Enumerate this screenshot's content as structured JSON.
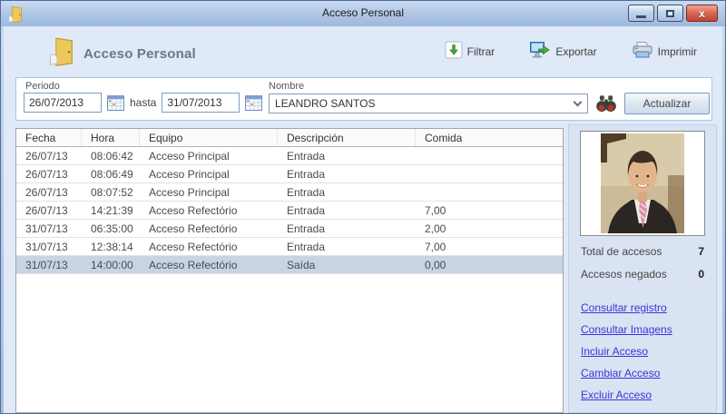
{
  "window": {
    "title": "Acceso Personal",
    "controls": {
      "minimize": "minimize",
      "maximize": "maximize",
      "close": "x"
    }
  },
  "header": {
    "title": "Acceso Personal",
    "actions": [
      {
        "label": "Filtrar",
        "icon": "filter-download-icon"
      },
      {
        "label": "Exportar",
        "icon": "export-monitor-icon"
      },
      {
        "label": "Imprimir",
        "icon": "printer-icon"
      }
    ]
  },
  "filter": {
    "periodo_label": "Periodo",
    "date_from": "26/07/2013",
    "hasta_label": "hasta",
    "date_to": "31/07/2013",
    "nombre_label": "Nombre",
    "nombre_value": "LEANDRO SANTOS",
    "actualizar_label": "Actualizar",
    "icons": [
      "calendar-icon",
      "calendar-icon",
      "chevron-down-icon",
      "binoculars-icon"
    ]
  },
  "table": {
    "columns": [
      "Fecha",
      "Hora",
      "Equipo",
      "Descripción",
      "Comida"
    ],
    "rows": [
      {
        "fecha": "26/07/13",
        "hora": "08:06:42",
        "equipo": "Acceso Principal",
        "descripcion": "Entrada",
        "comida": ""
      },
      {
        "fecha": "26/07/13",
        "hora": "08:06:49",
        "equipo": "Acceso Principal",
        "descripcion": "Entrada",
        "comida": ""
      },
      {
        "fecha": "26/07/13",
        "hora": "08:07:52",
        "equipo": "Acceso Principal",
        "descripcion": "Entrada",
        "comida": ""
      },
      {
        "fecha": "26/07/13",
        "hora": "14:21:39",
        "equipo": "Acceso Refectório",
        "descripcion": "Entrada",
        "comida": "7,00"
      },
      {
        "fecha": "31/07/13",
        "hora": "06:35:00",
        "equipo": "Acceso Refectório",
        "descripcion": "Entrada",
        "comida": "2,00"
      },
      {
        "fecha": "31/07/13",
        "hora": "12:38:14",
        "equipo": "Acceso Refectório",
        "descripcion": "Entrada",
        "comida": "7,00"
      },
      {
        "fecha": "31/07/13",
        "hora": "14:00:00",
        "equipo": "Acceso Refectório",
        "descripcion": "Saída",
        "comida": "0,00",
        "selected": true
      }
    ]
  },
  "sidebar": {
    "photo": "employee-portrait",
    "stats": [
      {
        "label": "Total de accesos",
        "value": "7"
      },
      {
        "label": "Accesos negados",
        "value": "0"
      }
    ],
    "links": [
      "Consultar registro",
      "Consultar Imagens",
      "Incluir Acceso",
      "Cambiar Acceso",
      "Excluir Acceso"
    ]
  },
  "colors": {
    "titlebar_top": "#cadbf1",
    "titlebar_bottom": "#9cb8dc",
    "content_bg": "#dfe9f7",
    "sidebar_bg": "#d9e3f2",
    "selected_row": "#c8d4e4",
    "link_blue": "#3636d8",
    "close_red": "#bf4635"
  }
}
